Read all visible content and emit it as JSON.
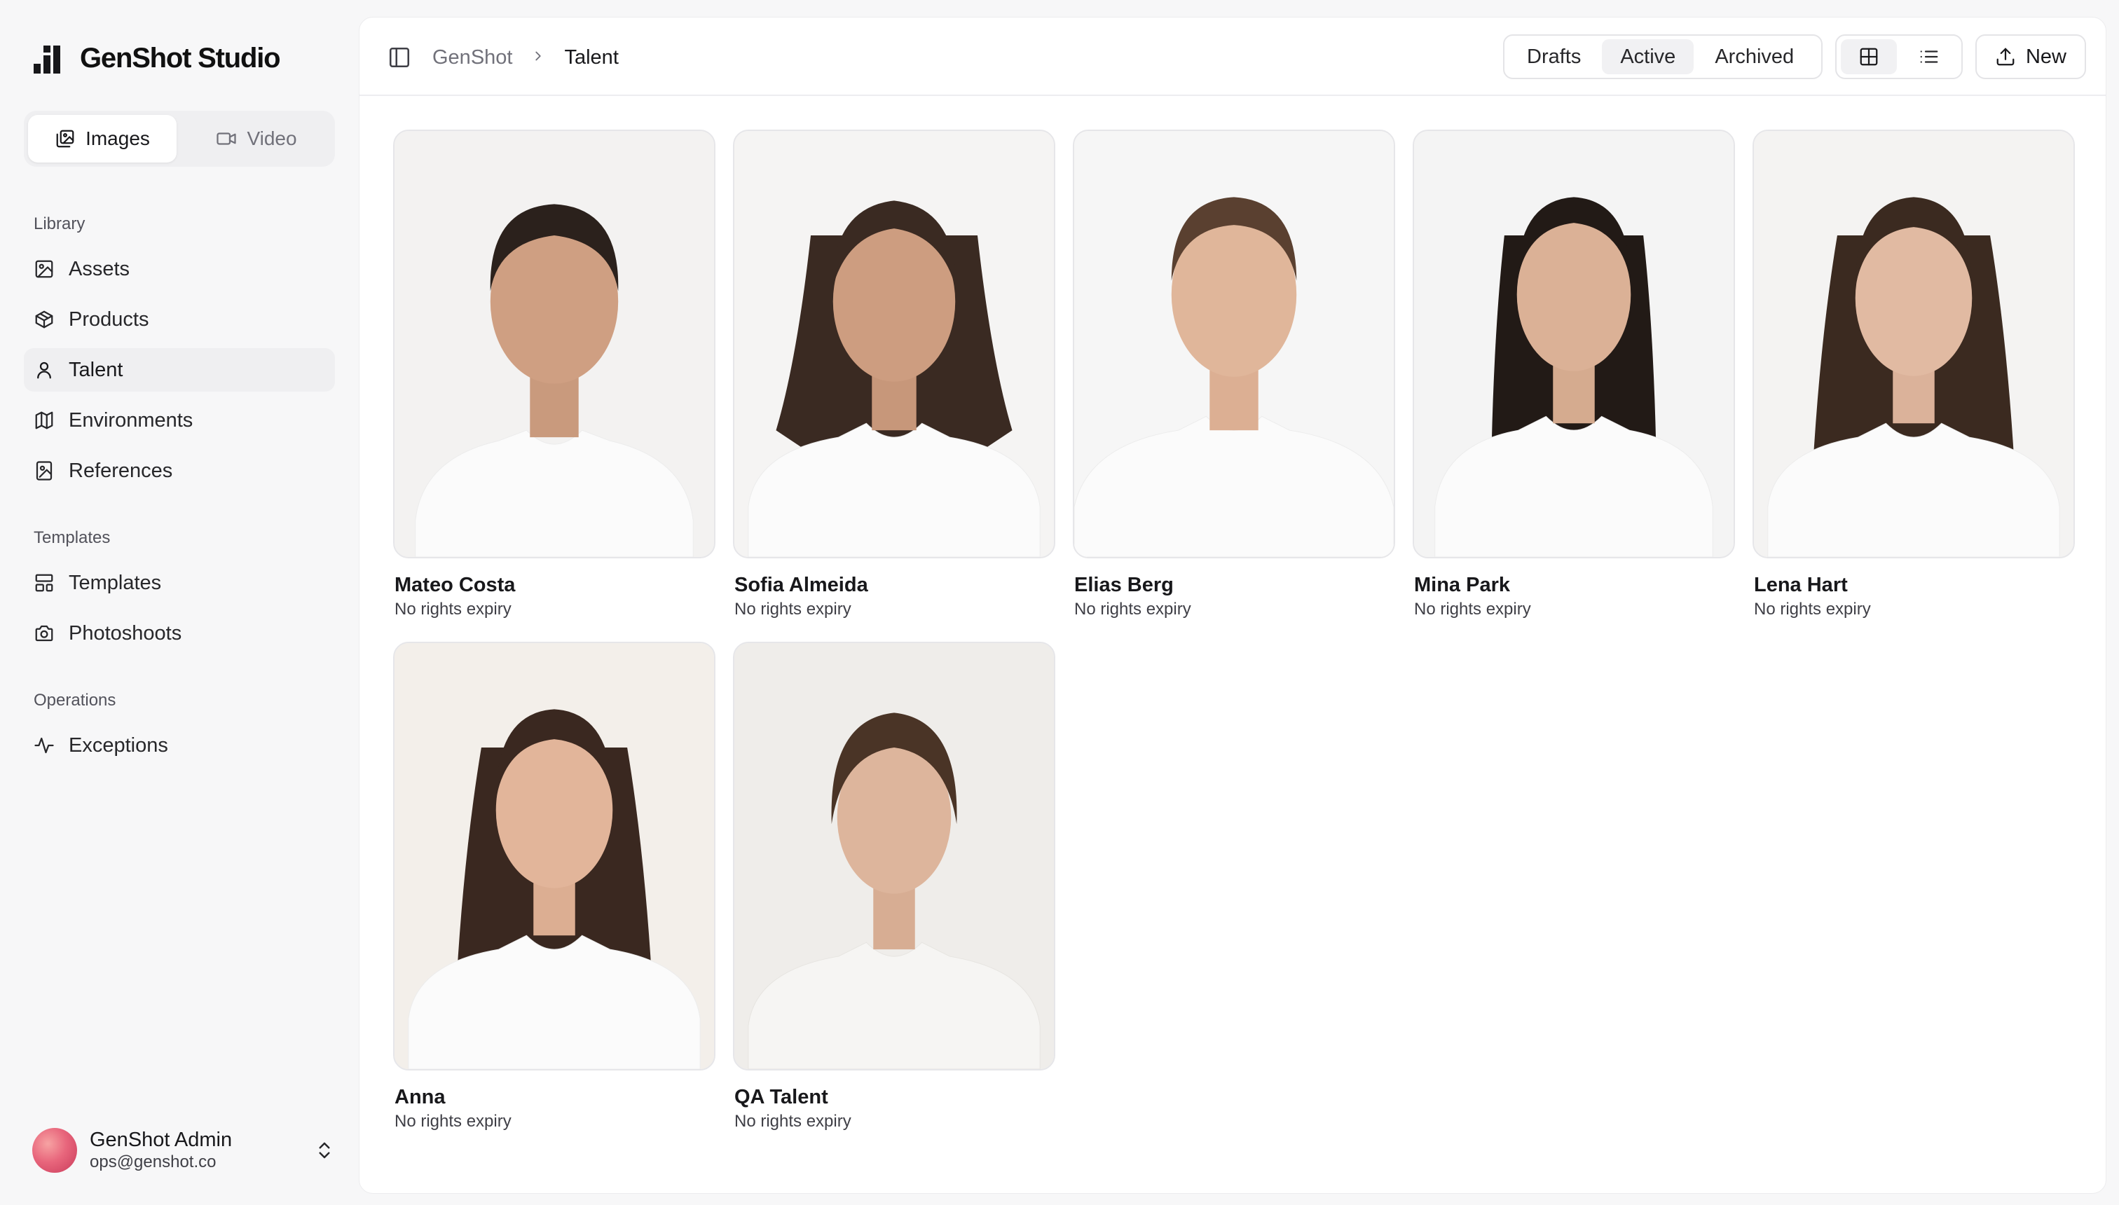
{
  "app": {
    "name": "GenShot Studio"
  },
  "mode_switch": {
    "images_label": "Images",
    "video_label": "Video",
    "active": "Images"
  },
  "nav": {
    "library_title": "Library",
    "library_items": [
      {
        "label": "Assets",
        "icon": "image-icon"
      },
      {
        "label": "Products",
        "icon": "box-icon"
      },
      {
        "label": "Talent",
        "icon": "user-icon"
      },
      {
        "label": "Environments",
        "icon": "map-icon"
      },
      {
        "label": "References",
        "icon": "image-file-icon"
      }
    ],
    "templates_title": "Templates",
    "templates_items": [
      {
        "label": "Templates",
        "icon": "layout-icon"
      },
      {
        "label": "Photoshoots",
        "icon": "camera-icon"
      }
    ],
    "operations_title": "Operations",
    "operations_items": [
      {
        "label": "Exceptions",
        "icon": "activity-icon"
      }
    ],
    "active_item": "Talent"
  },
  "user": {
    "name": "GenShot Admin",
    "email": "ops@genshot.co"
  },
  "breadcrumb": {
    "root": "GenShot",
    "current": "Talent"
  },
  "status_tabs": {
    "items": [
      "Drafts",
      "Active",
      "Archived"
    ],
    "active": "Active"
  },
  "view_toggle": {
    "active": "grid"
  },
  "new_button": {
    "label": "New"
  },
  "talent": [
    {
      "name": "Mateo Costa",
      "status": "No rights expiry"
    },
    {
      "name": "Sofia Almeida",
      "status": "No rights expiry"
    },
    {
      "name": "Elias Berg",
      "status": "No rights expiry"
    },
    {
      "name": "Mina Park",
      "status": "No rights expiry"
    },
    {
      "name": "Lena Hart",
      "status": "No rights expiry"
    },
    {
      "name": "Anna",
      "status": "No rights expiry"
    },
    {
      "name": "QA Talent",
      "status": "No rights expiry"
    }
  ],
  "colors": {
    "accent_text": "#18181b",
    "muted_text": "#71717a",
    "panel_bg": "#ffffff",
    "app_bg": "#f7f7f8"
  }
}
